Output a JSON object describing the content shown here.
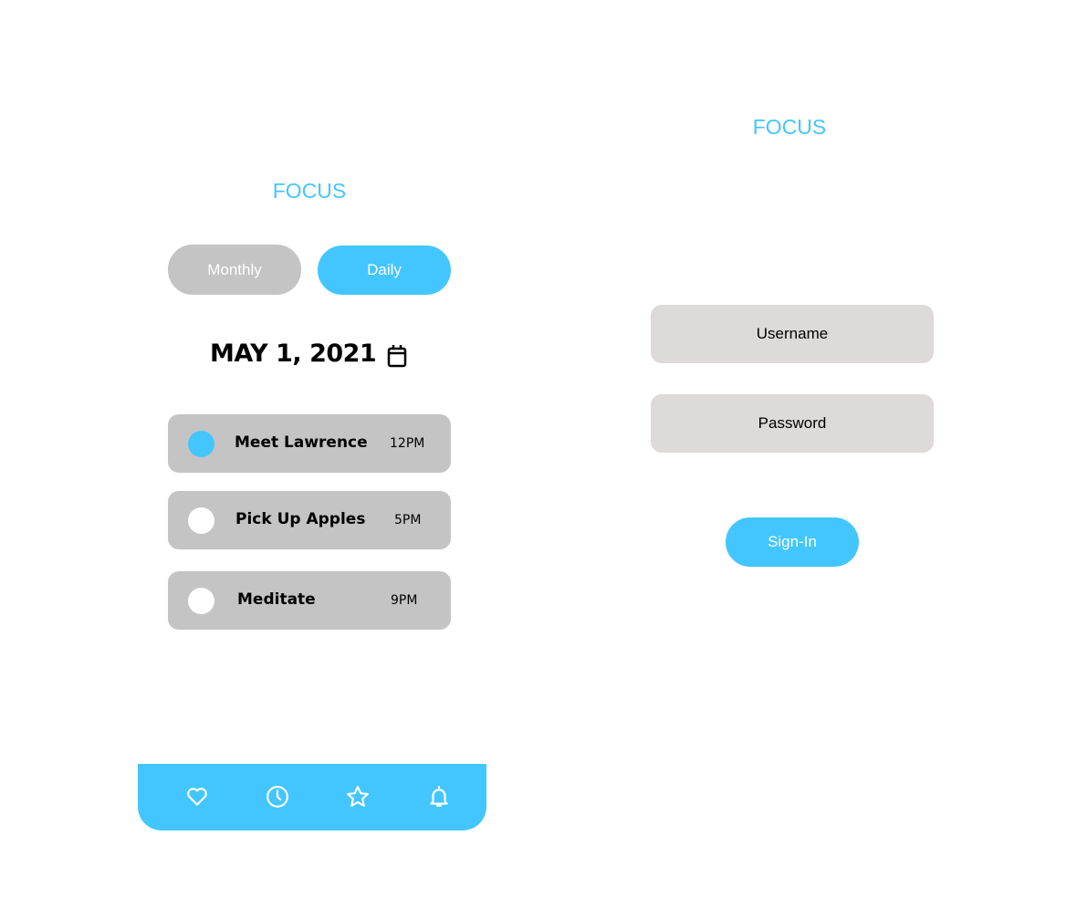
{
  "daily_screen": {
    "logo": "FOCUS",
    "tabs": [
      {
        "label": "Monthly",
        "active": false
      },
      {
        "label": "Daily",
        "active": true
      }
    ],
    "date": "MAY 1, 2021",
    "tasks": [
      {
        "name": "Meet Lawrence",
        "time": "12PM",
        "done": true
      },
      {
        "name": "Pick Up Apples",
        "time": "5PM",
        "done": false
      },
      {
        "name": "Meditate",
        "time": "9PM",
        "done": false
      }
    ],
    "nav_icons": [
      "heart-icon",
      "clock-icon",
      "star-icon",
      "bell-icon"
    ]
  },
  "login_screen": {
    "logo": "FOCUS",
    "username_placeholder": "Username",
    "password_placeholder": "Password",
    "signin_label": "Sign-In"
  },
  "colors": {
    "accent": "#43c6ff",
    "card": "#c4c4c4",
    "input": "#dddad9"
  }
}
